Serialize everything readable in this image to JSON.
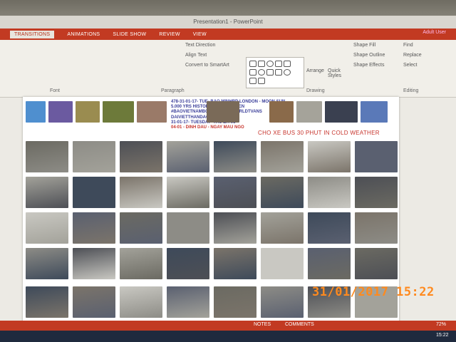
{
  "window": {
    "title": "Presentation1 - PowerPoint",
    "account": "Adult User"
  },
  "ribbon_tabs": [
    "TRANSITIONS",
    "ANIMATIONS",
    "SLIDE SHOW",
    "REVIEW",
    "VIEW"
  ],
  "ribbon": {
    "text_direction": "Text Direction",
    "align_text": "Align Text",
    "smartart": "Convert to SmartArt",
    "arrange": "Arrange",
    "quick_styles": "Quick Styles",
    "shape_fill": "Shape Fill",
    "shape_outline": "Shape Outline",
    "shape_effects": "Shape Effects",
    "find": "Find",
    "replace": "Replace",
    "select": "Select",
    "group_font": "Font",
    "group_paragraph": "Paragraph",
    "group_drawing": "Drawing",
    "group_editing": "Editing"
  },
  "slide": {
    "caption_lines": [
      "478-31-01-17- TUE- BAO MINHBP-LONDON - MOON SUN",
      "5.000 YRS HISTORYSKY NAMNHIEN",
      "#BAOVIETNAMBONPHUONG-WORLDTVANS",
      "DAIVIETTHANDAO-VIETTIANS"
    ],
    "date_line": "31-01-17- TUESDAY- THU BA-05",
    "red_line": "04-01 - DINH DAU - NGAY MAU NGO",
    "title": "CHO XE BUS 30 PHUT IN COLD WEATHER"
  },
  "statusbar": {
    "notes": "NOTES",
    "comments": "COMMENTS",
    "zoom": "72%"
  },
  "taskbar": {
    "clock": "15:22"
  },
  "camera_timestamp": "31/01/2017  15:22",
  "colors": {
    "accent": "#c23a22",
    "timestamp": "#ff8a1e",
    "caption_blue": "#3b3f9a"
  }
}
